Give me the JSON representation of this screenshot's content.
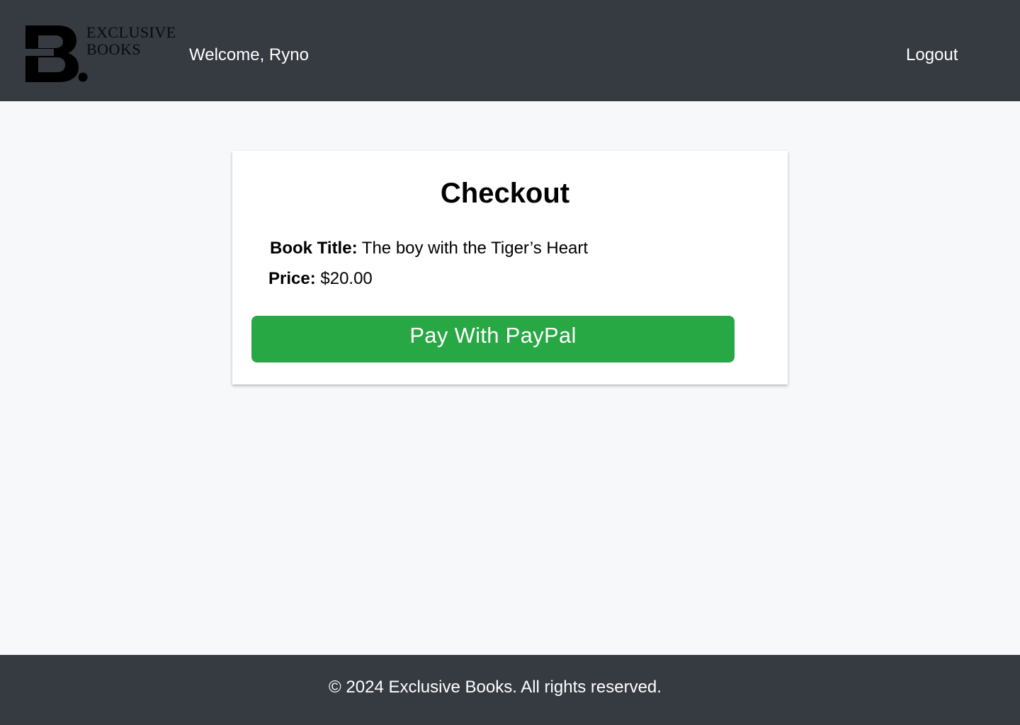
{
  "brand": {
    "logo_text_line1": "EXCLUSIVE",
    "logo_text_line2": "BOOKS",
    "logo_icon": "eb-logo-icon"
  },
  "header": {
    "welcome": "Welcome, Ryno",
    "logout_label": "Logout"
  },
  "checkout": {
    "title": "Checkout",
    "book_title_label": "Book Title:",
    "book_title": "The boy with the Tiger’s Heart",
    "price_label": "Price:",
    "price": "$20.00",
    "pay_button_label": "Pay With PayPal"
  },
  "footer": {
    "copyright": "© 2024 Exclusive Books. All rights reserved."
  },
  "colors": {
    "header_bg": "#363a41",
    "page_bg": "#f7f8fa",
    "card_bg": "#ffffff",
    "pay_button": "#28a745",
    "header_text": "#ffffff"
  }
}
